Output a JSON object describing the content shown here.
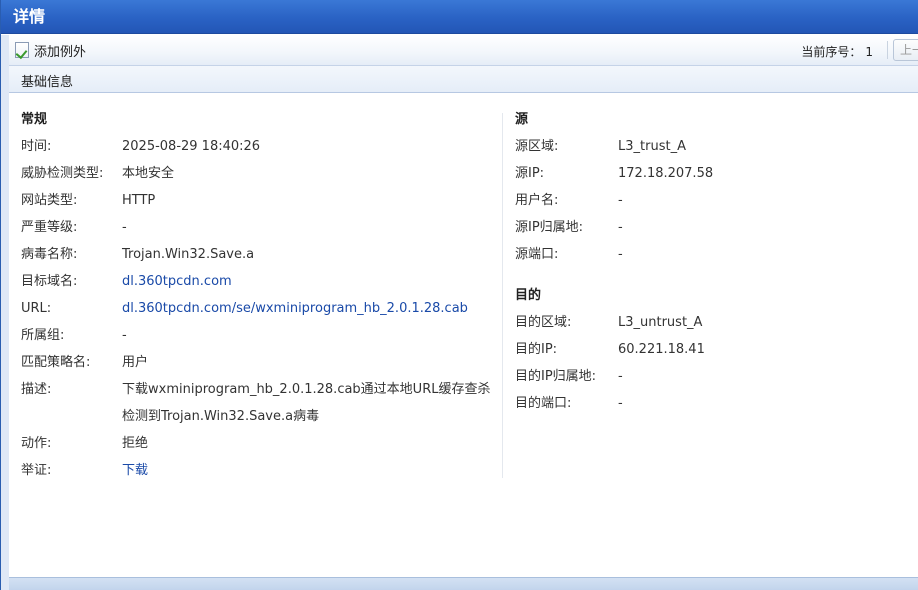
{
  "window": {
    "title": "详情"
  },
  "toolbar": {
    "add_exception_label": "添加例外",
    "seq_label": "当前序号：",
    "seq_value": "1",
    "prev_label": "上一"
  },
  "section": {
    "label": "基础信息"
  },
  "general": {
    "heading": "常规",
    "rows": [
      {
        "key": "时间:",
        "value": "2025-08-29 18:40:26"
      },
      {
        "key": "威胁检测类型:",
        "value": "本地安全"
      },
      {
        "key": "网站类型:",
        "value": "HTTP"
      },
      {
        "key": "严重等级:",
        "value": "-"
      },
      {
        "key": "病毒名称:",
        "value": "Trojan.Win32.Save.a"
      },
      {
        "key": "目标域名:",
        "value": "dl.360tpcdn.com"
      },
      {
        "key": "URL:",
        "value": "dl.360tpcdn.com/se/wxminiprogram_hb_2.0.1.28.cab"
      },
      {
        "key": "所属组:",
        "value": "-"
      },
      {
        "key": "匹配策略名:",
        "value": "用户"
      },
      {
        "key": "描述:",
        "value": "下载wxminiprogram_hb_2.0.1.28.cab通过本地URL缓存查杀检测到Trojan.Win32.Save.a病毒"
      },
      {
        "key": "动作:",
        "value": "拒绝"
      },
      {
        "key": "举证:",
        "value": "下载"
      }
    ]
  },
  "source": {
    "heading": "源",
    "rows": [
      {
        "key": "源区域:",
        "value": "L3_trust_A"
      },
      {
        "key": "源IP:",
        "value": "172.18.207.58"
      },
      {
        "key": "用户名:",
        "value": "-"
      },
      {
        "key": "源IP归属地:",
        "value": "-"
      },
      {
        "key": "源端口:",
        "value": "-"
      }
    ]
  },
  "destination": {
    "heading": "目的",
    "rows": [
      {
        "key": "目的区域:",
        "value": "L3_untrust_A"
      },
      {
        "key": "目的IP:",
        "value": "60.221.18.41"
      },
      {
        "key": "目的IP归属地:",
        "value": "-"
      },
      {
        "key": "目的端口:",
        "value": "-"
      }
    ]
  }
}
